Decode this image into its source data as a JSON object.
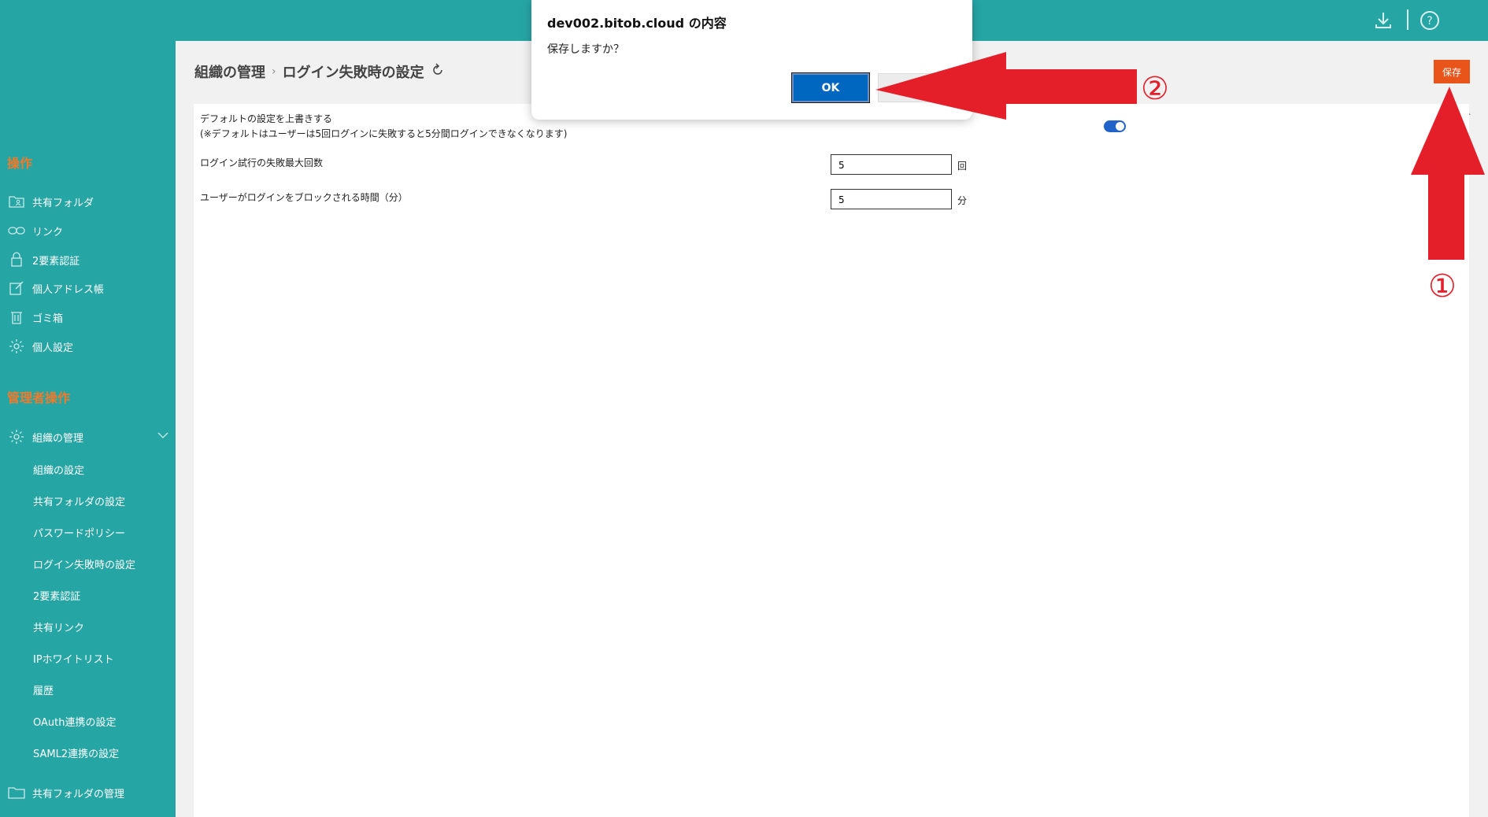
{
  "dialog": {
    "title": "dev002.bitob.cloud の内容",
    "message": "保存しますか？",
    "ok_label": "OK"
  },
  "header": {
    "download_icon": "download-icon",
    "help_icon": "help-icon"
  },
  "sidebar": {
    "section_ops": "操作",
    "ops_items": [
      {
        "label": "共有フォルダ",
        "icon": "folder-user-icon"
      },
      {
        "label": "リンク",
        "icon": "link-icon"
      },
      {
        "label": "2要素認証",
        "icon": "lock-icon"
      },
      {
        "label": "個人アドレス帳",
        "icon": "edit-icon"
      },
      {
        "label": "ゴミ箱",
        "icon": "trash-icon"
      },
      {
        "label": "個人設定",
        "icon": "gear-icon"
      }
    ],
    "section_admin": "管理者操作",
    "admin_group": {
      "label": "組織の管理",
      "icon": "gear-icon"
    },
    "admin_sub": [
      "組織の設定",
      "共有フォルダの設定",
      "パスワードポリシー",
      "ログイン失敗時の設定",
      "2要素認証",
      "共有リンク",
      "IPホワイトリスト",
      "履歴",
      "OAuth連携の設定",
      "SAML2連携の設定"
    ],
    "shared_folder_mgmt": {
      "label": "共有フォルダの管理",
      "icon": "folder-icon"
    }
  },
  "main": {
    "breadcrumb_parent": "組織の管理",
    "breadcrumb_sep": "›",
    "breadcrumb_current": "ログイン失敗時の設定",
    "save_label": "保存",
    "override_label": "デフォルトの設定を上書きする",
    "override_note": "(※デフォルトはユーザーは5回ログインに失敗すると5分間ログインできなくなります)",
    "override_enabled": true,
    "max_attempts_label": "ログイン試行の失敗最大回数",
    "max_attempts_value": "5",
    "max_attempts_unit": "回",
    "block_time_label": "ユーザーがログインをブロックされる時間（分）",
    "block_time_value": "5",
    "block_time_unit": "分"
  },
  "annotations": {
    "step1": "①",
    "step2": "②",
    "arrow_color": "#e41f2a"
  }
}
